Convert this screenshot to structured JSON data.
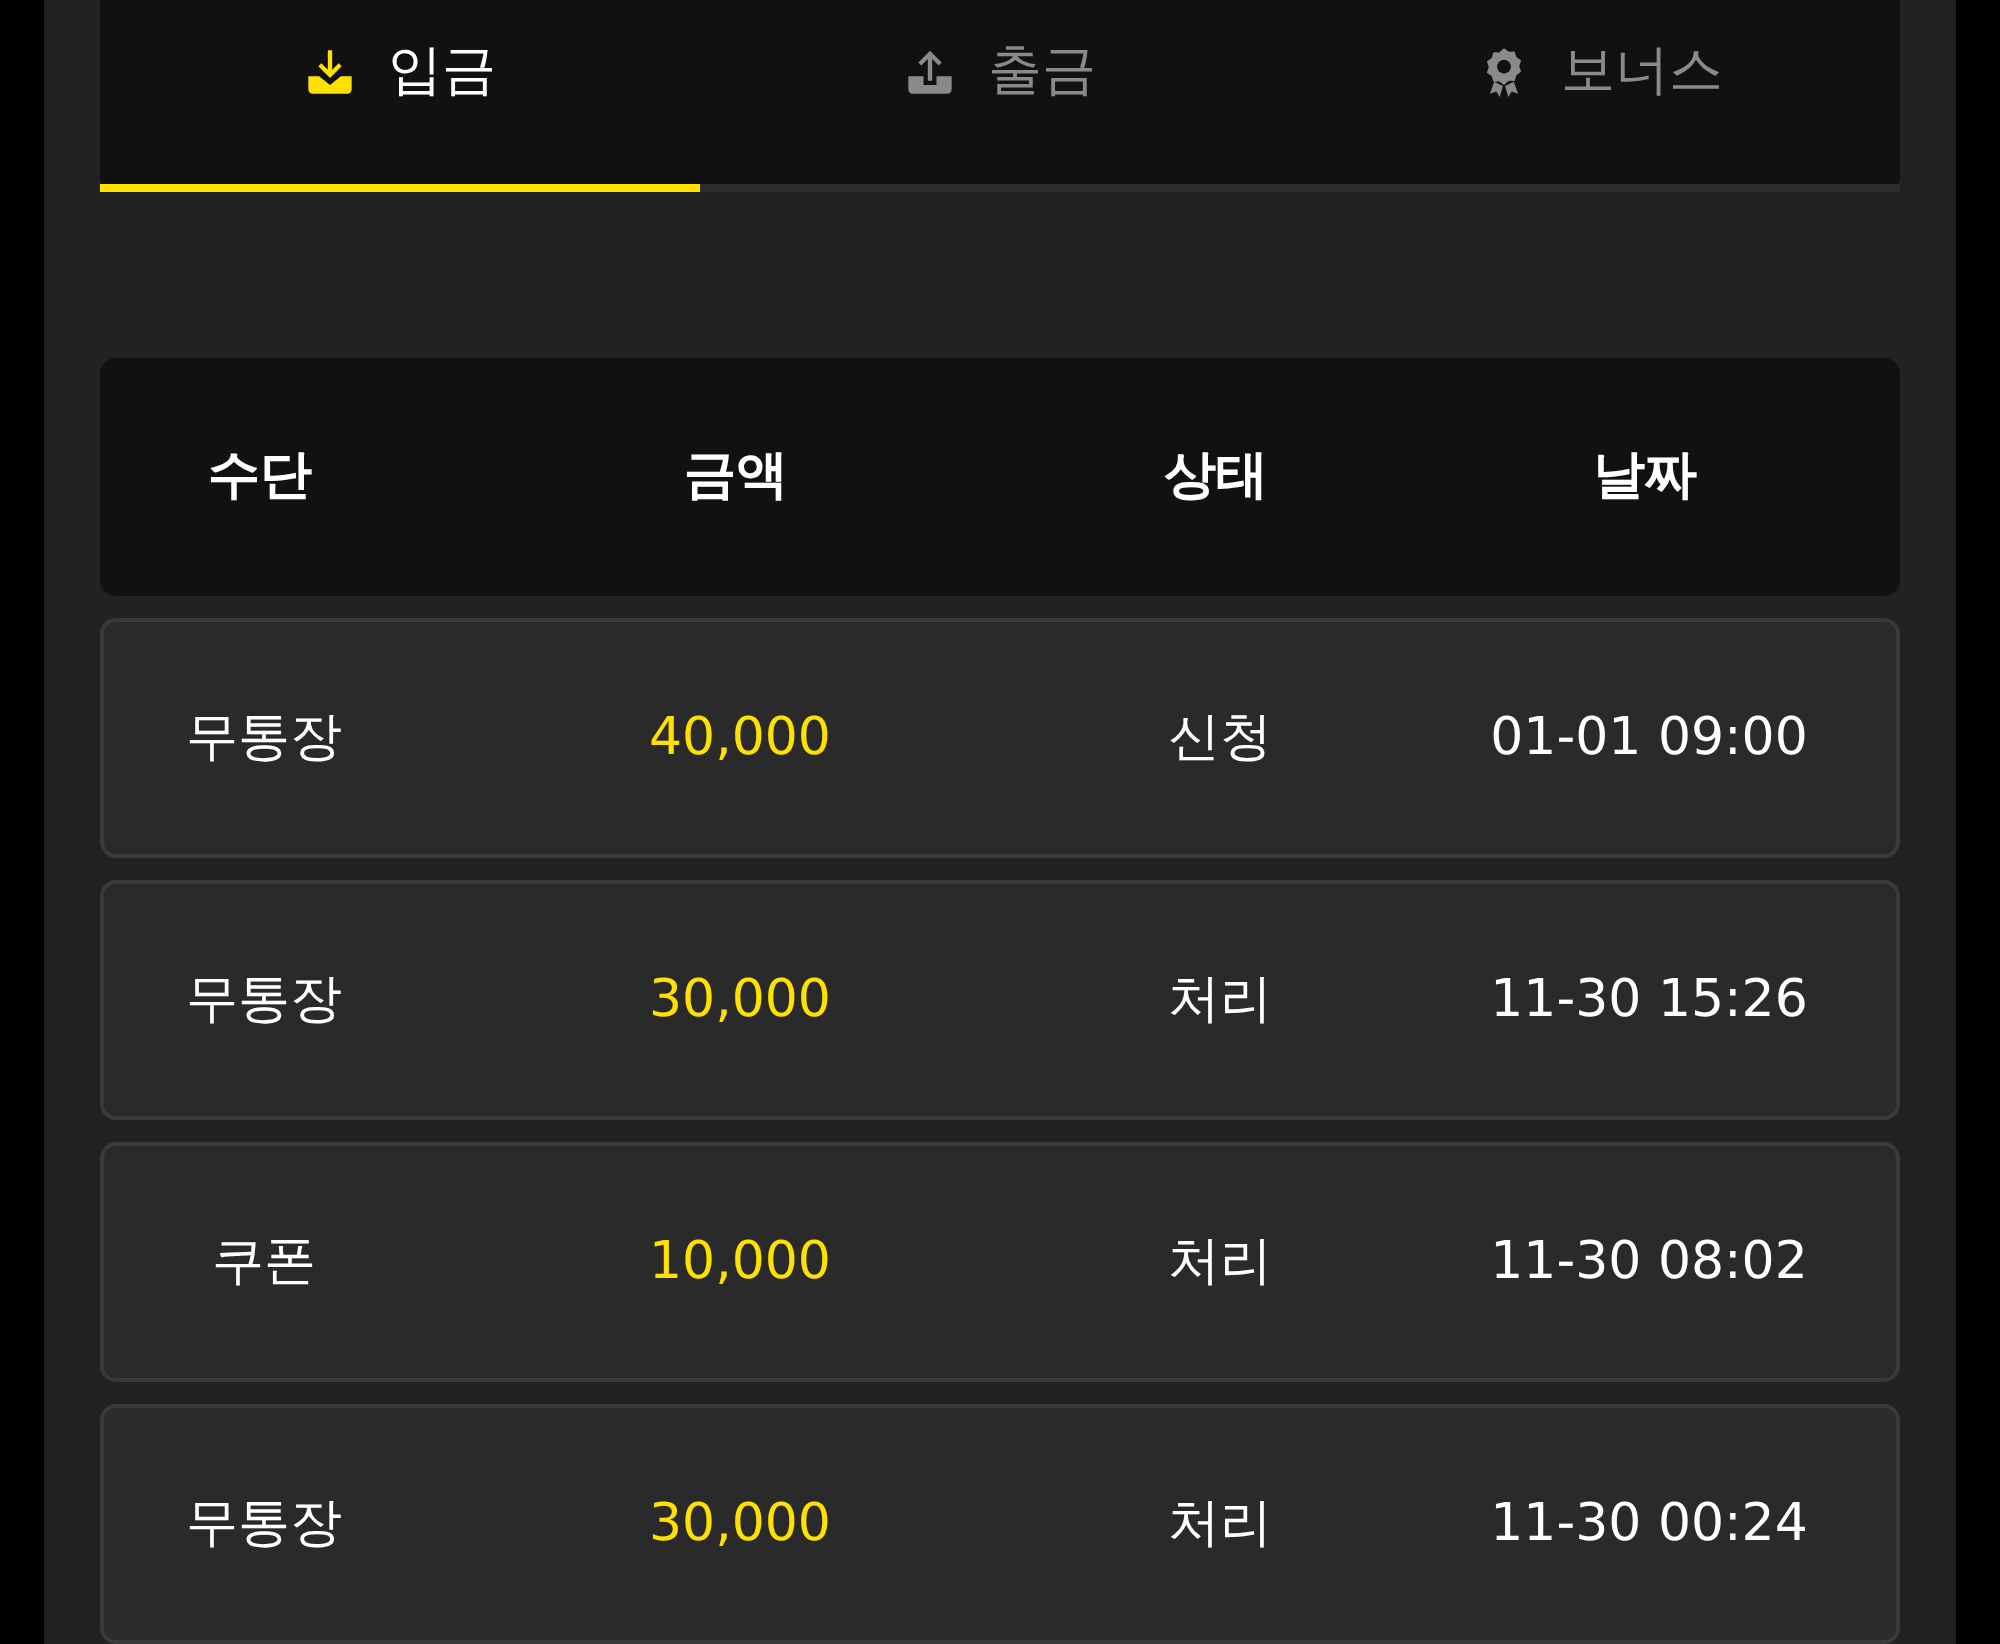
{
  "tabs": [
    {
      "label": "입금",
      "kind": "deposit",
      "selected": true
    },
    {
      "label": "출금",
      "kind": "withdraw",
      "selected": false
    },
    {
      "label": "보너스",
      "kind": "bonus",
      "selected": false
    }
  ],
  "table": {
    "columns": [
      "수단",
      "금액",
      "상태",
      "날짜"
    ],
    "rows": [
      {
        "method": "무통장",
        "amount": "40,000",
        "status": "신청",
        "date": "01-01 09:00"
      },
      {
        "method": "무통장",
        "amount": "30,000",
        "status": "처리",
        "date": "11-30 15:26"
      },
      {
        "method": "쿠폰",
        "amount": "10,000",
        "status": "처리",
        "date": "11-30 08:02"
      },
      {
        "method": "무통장",
        "amount": "30,000",
        "status": "처리",
        "date": "11-30 00:24"
      }
    ]
  }
}
